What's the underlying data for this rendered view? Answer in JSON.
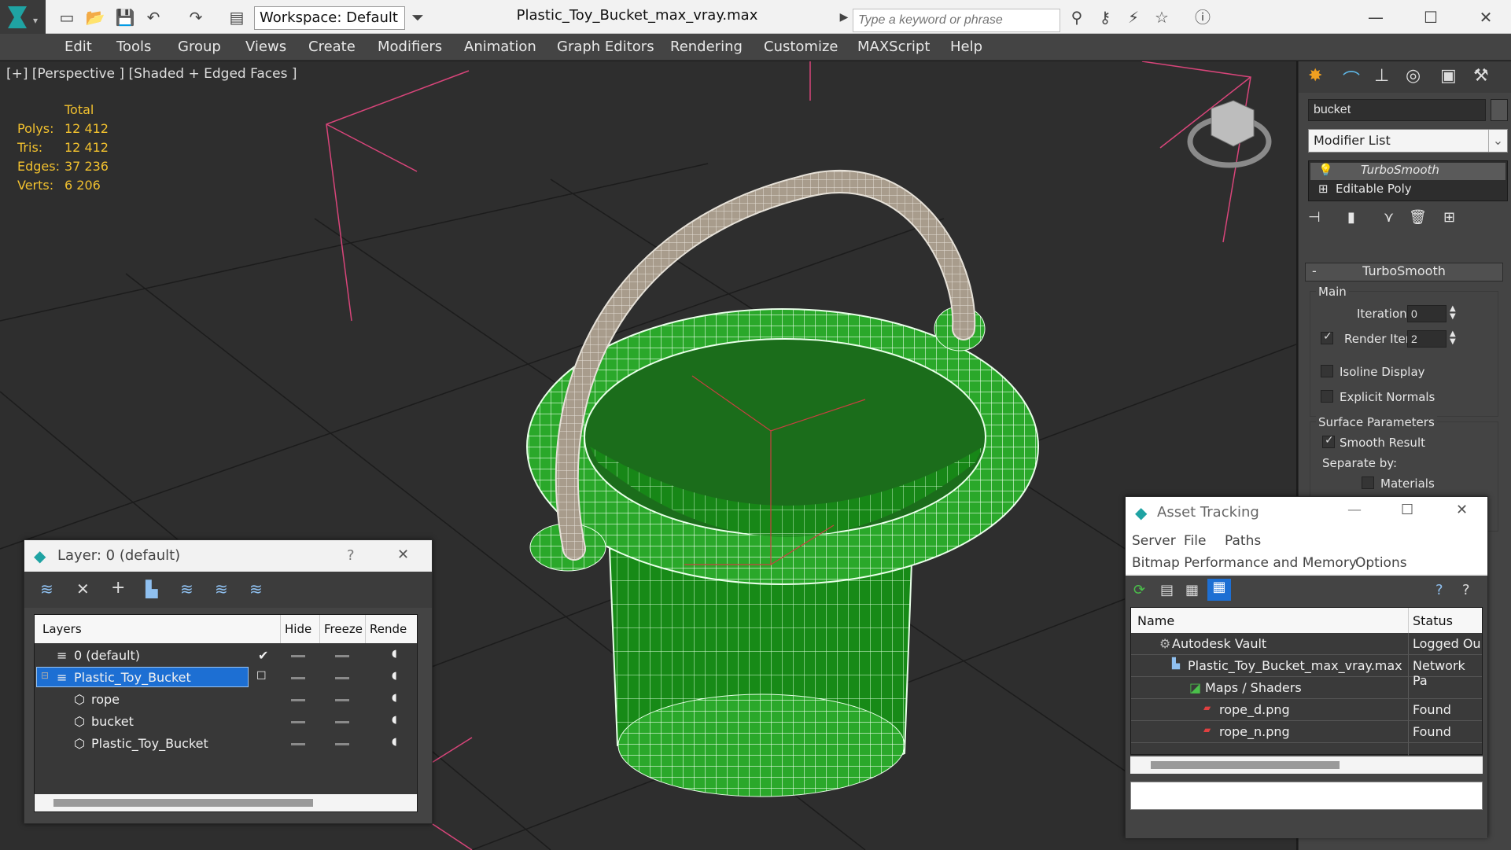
{
  "app": {
    "doc_title": "Plastic_Toy_Bucket_max_vray.max",
    "workspace_label": "Workspace: Default",
    "search_placeholder": "Type a keyword or phrase",
    "win_controls": {
      "minimize": "—",
      "maximize": "☐",
      "close": "✕"
    }
  },
  "menu": [
    "Edit",
    "Tools",
    "Group",
    "Views",
    "Create",
    "Modifiers",
    "Animation",
    "Graph Editors",
    "Rendering",
    "Customize",
    "MAXScript",
    "Help"
  ],
  "viewport": {
    "label": "[+] [Perspective ] [Shaded + Edged Faces ]",
    "stats": {
      "header": "Total",
      "rows": [
        {
          "label": "Polys:",
          "value": "12 412"
        },
        {
          "label": "Tris:",
          "value": "12 412"
        },
        {
          "label": "Edges:",
          "value": "37 236"
        },
        {
          "label": "Verts:",
          "value": "6 206"
        }
      ]
    }
  },
  "command_panel": {
    "object_name": "bucket",
    "modifier_list": "Modifier List",
    "stack": [
      "TurboSmooth",
      "Editable Poly"
    ],
    "rollout_title": "TurboSmooth",
    "rollout_collapse": "-",
    "main_group": "Main",
    "iterations_label": "Iterations:",
    "iterations_value": "0",
    "render_iters_label": "Render Iters:",
    "render_iters_value": "2",
    "isoline_label": "Isoline Display",
    "explicit_normals_label": "Explicit Normals",
    "surface_params_label": "Surface Parameters",
    "smooth_result_label": "Smooth Result",
    "separate_by_label": "Separate by:",
    "materials_label": "Materials",
    "render_iters_checked": true,
    "smooth_result_checked": true
  },
  "layer_window": {
    "title": "Layer: 0 (default)",
    "help": "?",
    "close": "✕",
    "columns": [
      "Layers",
      "Hide",
      "Freeze",
      "Rende"
    ],
    "rows": [
      {
        "name": "0 (default)",
        "indent": 0,
        "active": true,
        "selected": false
      },
      {
        "name": "Plastic_Toy_Bucket",
        "indent": 0,
        "active": false,
        "selected": true
      },
      {
        "name": "rope",
        "indent": 1,
        "active": false,
        "selected": false
      },
      {
        "name": "bucket",
        "indent": 1,
        "active": false,
        "selected": false
      },
      {
        "name": "Plastic_Toy_Bucket",
        "indent": 1,
        "active": false,
        "selected": false
      }
    ]
  },
  "asset_window": {
    "title": "Asset Tracking",
    "menu_row1": [
      "Server",
      "File",
      "Paths"
    ],
    "menu_row2": [
      "Bitmap Performance and Memory",
      "Options"
    ],
    "columns": [
      "Name",
      "Status"
    ],
    "rows": [
      {
        "name": "Autodesk Vault",
        "status": "Logged Ou",
        "icon": "vault-icon",
        "indent": 1
      },
      {
        "name": "Plastic_Toy_Bucket_max_vray.max",
        "status": "Network Pa",
        "icon": "max-file-icon",
        "indent": 2
      },
      {
        "name": "Maps / Shaders",
        "status": "",
        "icon": "maps-icon",
        "indent": 3
      },
      {
        "name": "rope_d.png",
        "status": "Found",
        "icon": "png-icon",
        "indent": 4
      },
      {
        "name": "rope_n.png",
        "status": "Found",
        "icon": "png-icon",
        "indent": 4
      }
    ]
  },
  "colors": {
    "accent": "#1d6fd3",
    "stats_text": "#f2c12e",
    "bucket_green": "#2fb82f",
    "rope": "#a59a8a"
  }
}
